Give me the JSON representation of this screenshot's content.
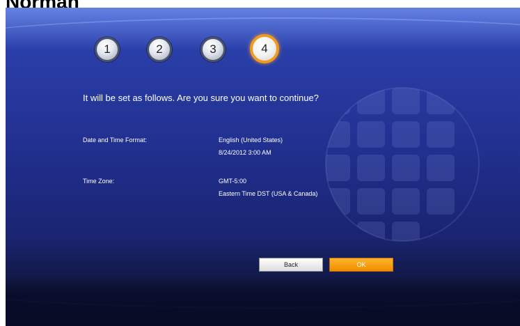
{
  "page_heading": "Norman",
  "steps": [
    {
      "label": "1",
      "active": false
    },
    {
      "label": "2",
      "active": false
    },
    {
      "label": "3",
      "active": false
    },
    {
      "label": "4",
      "active": true
    }
  ],
  "question": "It will be set as follows. Are you sure you want to continue?",
  "settings": {
    "date_time": {
      "label": "Date and Time Format:",
      "line1": "English (United States)",
      "line2": "8/24/2012 3:00 AM"
    },
    "time_zone": {
      "label": "Time Zone:",
      "line1": "GMT-5:00",
      "line2": "Eastern Time DST (USA & Canada)"
    }
  },
  "buttons": {
    "back": "Back",
    "ok": "OK"
  },
  "colors": {
    "accent": "#f29a1c",
    "background_top": "#3550c0",
    "background_bottom": "#0a0e28"
  },
  "icons": {
    "background_globe": "globe-icon"
  }
}
